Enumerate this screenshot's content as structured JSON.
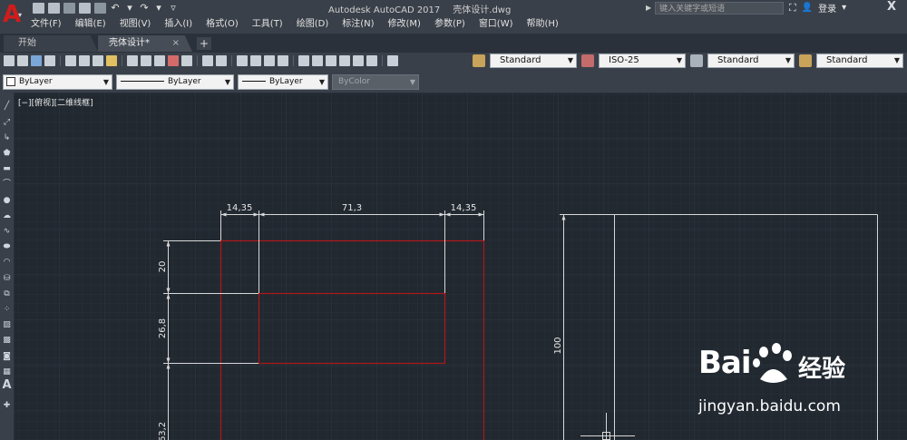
{
  "app": {
    "logo_letter": "A",
    "title": "Autodesk AutoCAD 2017",
    "file": "壳体设计.dwg"
  },
  "search": {
    "placeholder": "键入关键字或短语"
  },
  "user": {
    "login": "登录"
  },
  "menu": [
    "文件(F)",
    "编辑(E)",
    "视图(V)",
    "插入(I)",
    "格式(O)",
    "工具(T)",
    "绘图(D)",
    "标注(N)",
    "修改(M)",
    "参数(P)",
    "窗口(W)",
    "帮助(H)"
  ],
  "tabs": {
    "home": "开始",
    "doc": "壳体设计*",
    "close": "×",
    "add": "+"
  },
  "styles": {
    "text_style": "Standard",
    "dim_style": "ISO-25",
    "table_style": "Standard",
    "multileader_style": "Standard"
  },
  "properties": {
    "layer": "ByLayer",
    "linetype": "ByLayer",
    "lineweight": "ByLayer",
    "color": "ByColor"
  },
  "viewport": {
    "label": "[−][俯视][二维线框]"
  },
  "dimensions": {
    "left_width": "14,35",
    "middle_width": "71,3",
    "right_width": "14,35",
    "top_height": "20",
    "mid_height": "26,8",
    "lower_height": "63,2",
    "right_height": "100"
  },
  "watermark": {
    "brand": "Bai",
    "brand_cn": "经验",
    "url": "jingyan.baidu.com"
  },
  "colors": {
    "canvas": "#212830",
    "chrome": "#3a4049",
    "red_line": "#b01818",
    "dim_line": "#d8d8d8"
  }
}
